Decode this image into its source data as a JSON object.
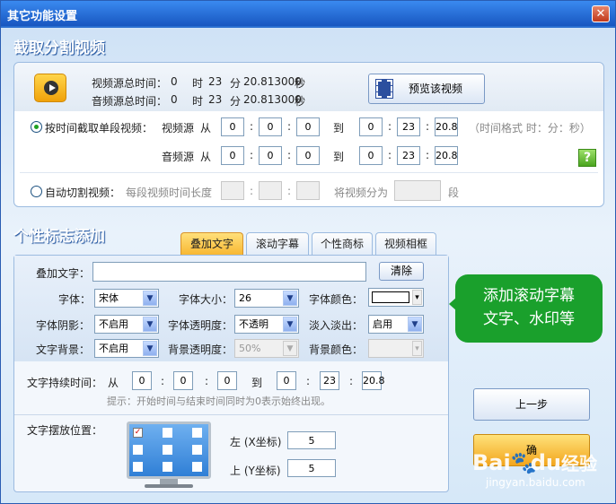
{
  "window": {
    "title": "其它功能设置",
    "close": "✕"
  },
  "capture": {
    "section_title": "截取分割视频",
    "video_total_label": "视频源总时间：",
    "audio_total_label": "音频源总时间：",
    "video_total": {
      "h": "0",
      "h_unit": "时",
      "m": "23",
      "m_unit": "分",
      "s": "20.813000",
      "s_unit": "秒"
    },
    "audio_total": {
      "h": "0",
      "h_unit": "时",
      "m": "23",
      "m_unit": "分",
      "s": "20.813000",
      "s_unit": "秒"
    },
    "preview_button": "预览该视频",
    "single_mode_label": "按时间截取单段视频：",
    "video_src_label": "视频源",
    "audio_src_label": "音频源",
    "from": "从",
    "to": "到",
    "colon": ":",
    "video_from": [
      "0",
      "0",
      "0"
    ],
    "video_to": [
      "0",
      "23",
      "20.8"
    ],
    "audio_from": [
      "0",
      "0",
      "0"
    ],
    "audio_to": [
      "0",
      "23",
      "20.8"
    ],
    "time_format_hint": "（时间格式 时：分：秒）",
    "help": "?",
    "auto_mode_label": "自动切割视频：",
    "segment_length_label": "每段视频时间长度",
    "split_into_label": "将视频分为",
    "segment_unit": "段"
  },
  "logo": {
    "section_title": "个性标志添加",
    "tabs": [
      "叠加文字",
      "滚动字幕",
      "个性商标",
      "视频相框"
    ],
    "overlay_text_label": "叠加文字：",
    "overlay_text_value": "",
    "clear_button": "清除",
    "font_label": "字体：",
    "font_value": "宋体",
    "font_size_label": "字体大小：",
    "font_size_value": "26",
    "font_color_label": "字体颜色：",
    "font_color_value": "#ffffff",
    "shadow_label": "字体阴影：",
    "shadow_value": "不启用",
    "opacity_label": "字体透明度：",
    "opacity_value": "不透明",
    "fade_label": "淡入淡出：",
    "fade_value": "启用",
    "bg_label": "文字背景：",
    "bg_value": "不启用",
    "bg_opacity_label": "背景透明度：",
    "bg_opacity_value": "50%",
    "bg_color_label": "背景颜色：",
    "duration_label": "文字持续时间：",
    "duration_from": [
      "0",
      "0",
      "0"
    ],
    "duration_to": [
      "0",
      "23",
      "20.8"
    ],
    "duration_hint": "提示：开始时间与结束时间同时为0表示始终出现。",
    "position_label": "文字摆放位置：",
    "left_label": "左 (X坐标)",
    "left_value": "5",
    "top_label": "上 (Y坐标)",
    "top_value": "5"
  },
  "side": {
    "callout": "添加滚动字幕\n文字、水印等",
    "prev_button": "上一步",
    "next_button": "确"
  },
  "watermark": {
    "brand": "Bai",
    "brand2": "du",
    "brand3": "经验",
    "url": "jingyan.baidu.com"
  },
  "colors": {
    "accent": "#1e66c9",
    "callout": "#1aa02c",
    "tab_active": "#f7b42d"
  }
}
